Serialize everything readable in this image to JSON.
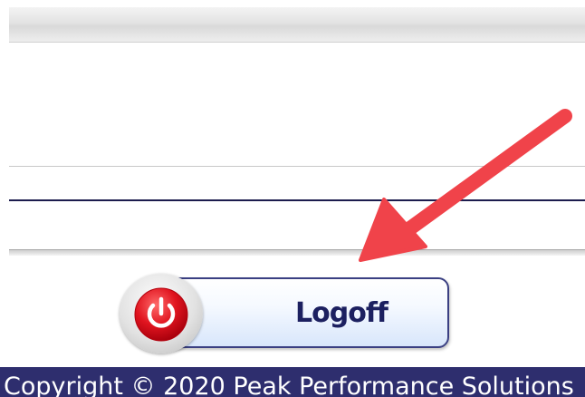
{
  "logoff_button": {
    "label": "Logoff"
  },
  "icons": {
    "power": "power-icon",
    "annotation_arrow": "arrow-icon"
  },
  "footer": {
    "copyright": "Copyright © 2020 Peak Performance Solutions"
  },
  "colors": {
    "navy": "#1c2060",
    "footer_bg": "#2e2e6e",
    "power_red": "#e0141f",
    "arrow_red": "#f0434a"
  }
}
